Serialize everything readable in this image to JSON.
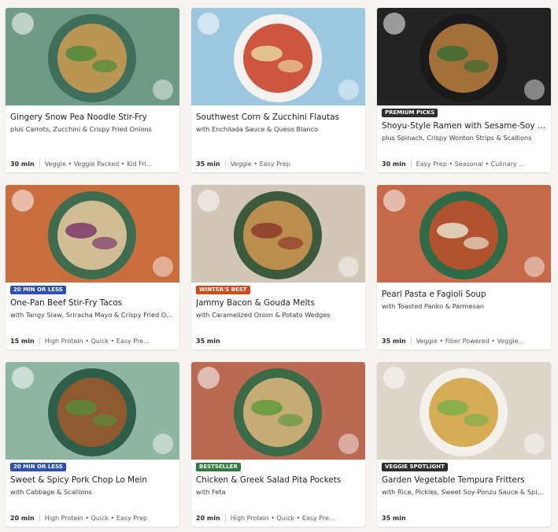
{
  "recipes": [
    {
      "title": "Gingery Snow Pea Noodle Stir-Fry",
      "subtitle": "plus Carrots, Zucchini & Crispy Fried Onions",
      "time": "30 min",
      "tags": "Veggie • Veggie Packed • Kid Fri...",
      "badge": "",
      "bg": "#6f9b86",
      "plate": "#3f6f5a",
      "food": "#c79a52",
      "accent": "#4e8a3a"
    },
    {
      "title": "Southwest Corn & Zucchini Flautas",
      "subtitle": "with Enchilada Sauce & Queso Blanco",
      "time": "35 min",
      "tags": "Veggie • Easy Prep",
      "badge": "",
      "bg": "#9cc7df",
      "plate": "#f4f2ee",
      "food": "#c9452d",
      "accent": "#e9d39a"
    },
    {
      "title": "Shoyu-Style Ramen with Sesame-Soy S...",
      "subtitle": "plus Spinach, Crispy Wonton Strips & Scallions",
      "time": "30 min",
      "tags": "Easy Prep • Seasonal • Culinary ...",
      "badge": "PREMIUM PICKS",
      "badge_style": "dark",
      "bg": "#232323",
      "plate": "#1a1a1a",
      "food": "#b27a3e",
      "accent": "#3d6b33"
    },
    {
      "title": "One-Pan Beef Stir-Fry Tacos",
      "subtitle": "with Tangy Slaw, Sriracha Mayo & Crispy Fried Onions",
      "time": "15 min",
      "tags": "High Protein • Quick • Easy Pre...",
      "badge": "20 MIN OR LESS",
      "badge_style": "blue",
      "bg": "#c96e3f",
      "plate": "#3f6b4f",
      "food": "#e0c79a",
      "accent": "#7b3a6a"
    },
    {
      "title": "Jammy Bacon & Gouda Melts",
      "subtitle": "with Caramelized Onion & Potato Wedges",
      "time": "35 min",
      "tags": "",
      "badge": "WINTER'S BEST",
      "badge_style": "orange",
      "bg": "#d2c6b8",
      "plate": "#3e5a3c",
      "food": "#c99450",
      "accent": "#8c3a2b"
    },
    {
      "title": "Pearl Pasta e Fagioli Soup",
      "subtitle": "with Toasted Panko & Parmesan",
      "time": "35 min",
      "tags": "Veggie • Fiber Powered • Veggie...",
      "badge": "",
      "bg": "#c46a4a",
      "plate": "#2e6a45",
      "food": "#c0512b",
      "accent": "#e8dfca"
    },
    {
      "title": "Sweet & Spicy Pork Chop Lo Mein",
      "subtitle": "with Cabbage & Scallions",
      "time": "20 min",
      "tags": "High Protein • Quick • Easy Prep",
      "badge": "20 MIN OR LESS",
      "badge_style": "blue",
      "bg": "#8fb6a3",
      "plate": "#2f5f4a",
      "food": "#9a5a2e",
      "accent": "#5b8a3a"
    },
    {
      "title": "Chicken & Greek Salad Pita Pockets",
      "subtitle": "with Feta",
      "time": "20 min",
      "tags": "High Protein • Quick • Easy Pre...",
      "badge": "BESTSELLER",
      "badge_style": "green",
      "bg": "#b86b52",
      "plate": "#3a6a48",
      "food": "#d7b27a",
      "accent": "#5f9a3e"
    },
    {
      "title": "Garden Vegetable Tempura Fritters",
      "subtitle": "with Rice, Pickles, Sweet Soy-Ponzu Sauce & Spicy ...",
      "time": "35 min",
      "tags": "",
      "badge": "VEGGIE SPOTLIGHT",
      "badge_style": "dark",
      "bg": "#dcd6cb",
      "plate": "#f3f1ec",
      "food": "#d3a447",
      "accent": "#7fae4a"
    }
  ]
}
